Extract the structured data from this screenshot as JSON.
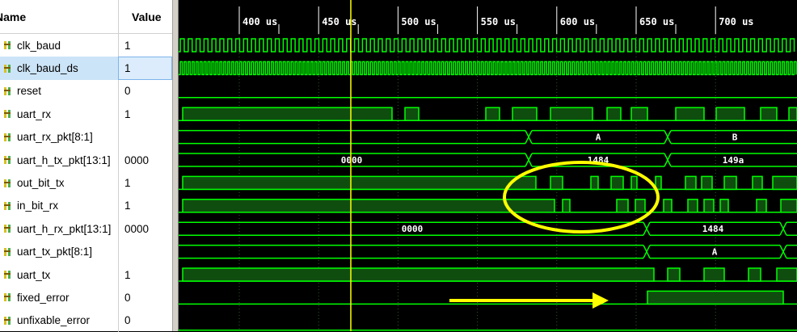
{
  "headers": {
    "name": "Name",
    "value": "Value"
  },
  "signals": [
    {
      "name": "clk_baud",
      "value": "1",
      "icon": "bit-signal-icon"
    },
    {
      "name": "clk_baud_ds",
      "value": "1",
      "icon": "bit-signal-icon",
      "selected": true
    },
    {
      "name": "reset",
      "value": "0",
      "icon": "bit-signal-icon"
    },
    {
      "name": "uart_rx",
      "value": "1",
      "icon": "bit-signal-icon"
    },
    {
      "name": "uart_rx_pkt[8:1]",
      "value": "",
      "icon": "bus-signal-icon"
    },
    {
      "name": "uart_h_tx_pkt[13:1]",
      "value": "0000",
      "icon": "bus-signal-icon"
    },
    {
      "name": "out_bit_tx",
      "value": "1",
      "icon": "bit-signal-icon"
    },
    {
      "name": "in_bit_rx",
      "value": "1",
      "icon": "bit-signal-icon"
    },
    {
      "name": "uart_h_rx_pkt[13:1]",
      "value": "0000",
      "icon": "bus-signal-icon"
    },
    {
      "name": "uart_tx_pkt[8:1]",
      "value": "",
      "icon": "bus-signal-icon"
    },
    {
      "name": "uart_tx",
      "value": "1",
      "icon": "bit-signal-icon"
    },
    {
      "name": "fixed_error",
      "value": "0",
      "icon": "bit-signal-icon"
    },
    {
      "name": "unfixable_error",
      "value": "0",
      "icon": "bit-signal-icon"
    }
  ],
  "timeline": {
    "ticks": [
      "400 us",
      "450 us",
      "500 us",
      "550 us",
      "600 us",
      "650 us",
      "700 us"
    ],
    "cursor_time_us": 468
  },
  "bus_labels": {
    "uart_rx_pkt": [
      "A",
      "B"
    ],
    "uart_h_tx_pkt": [
      "0000",
      "1484",
      "149a"
    ],
    "uart_h_rx_pkt": [
      "0000",
      "1484"
    ],
    "uart_tx_pkt": [
      "A"
    ]
  },
  "colors": {
    "wave_green": "#00ff00",
    "wave_fill": "#0f4d0f",
    "cursor": "#ffff00",
    "annotation": "#ffff00",
    "background": "#000000"
  },
  "annotations": {
    "ellipse_icon": "highlight-ellipse",
    "arrow_icon": "right-arrow"
  }
}
